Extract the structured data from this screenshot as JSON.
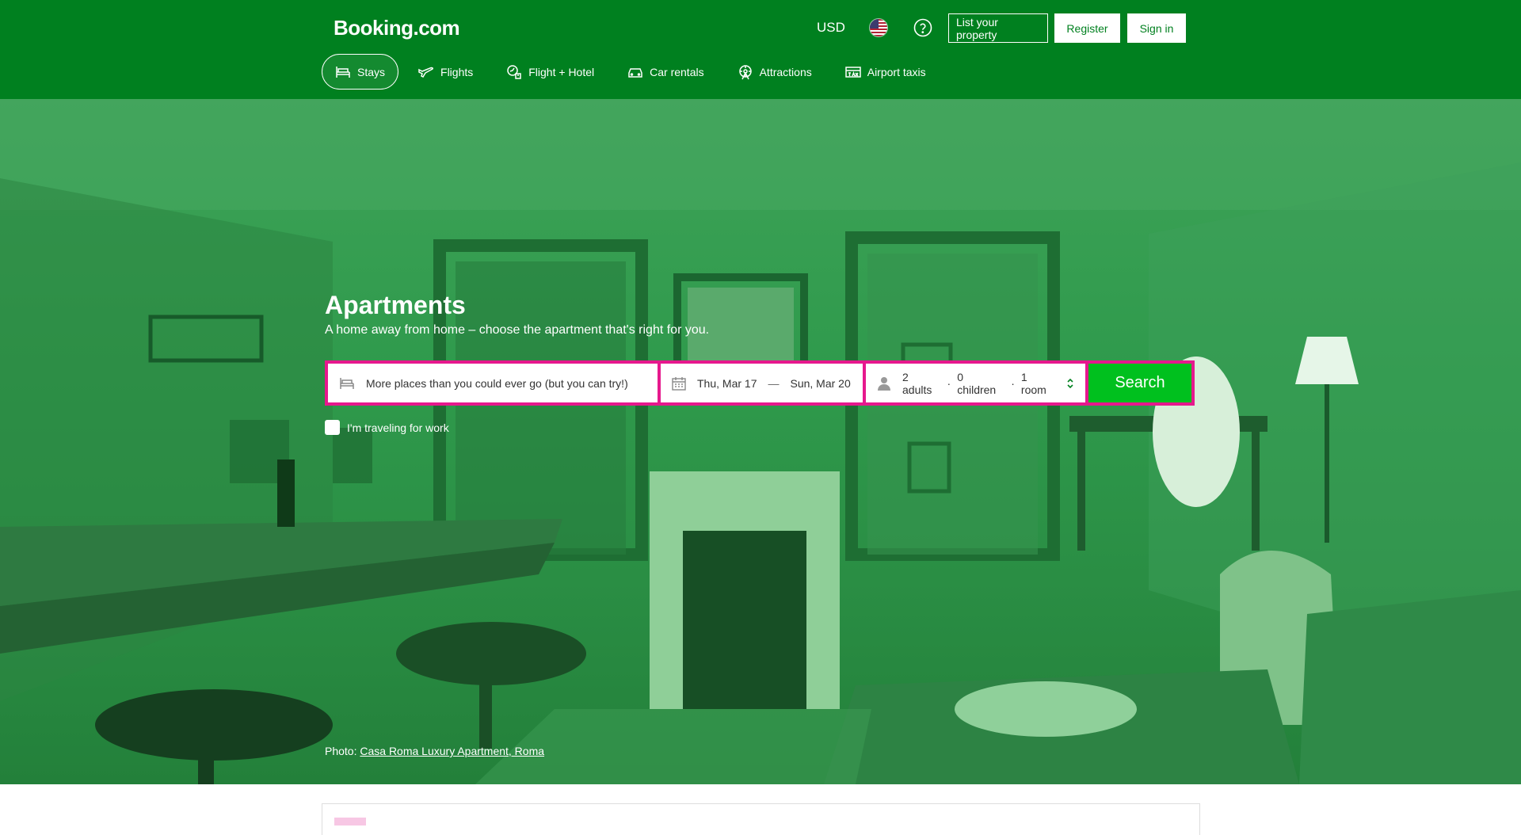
{
  "header": {
    "logo": "Booking.com",
    "currency": "USD",
    "list_property": "List your property",
    "register": "Register",
    "sign_in": "Sign in"
  },
  "nav": {
    "items": [
      {
        "label": "Stays",
        "icon": "bed-icon",
        "active": true
      },
      {
        "label": "Flights",
        "icon": "plane-icon",
        "active": false
      },
      {
        "label": "Flight + Hotel",
        "icon": "plane-hotel-icon",
        "active": false
      },
      {
        "label": "Car rentals",
        "icon": "car-icon",
        "active": false
      },
      {
        "label": "Attractions",
        "icon": "attractions-icon",
        "active": false
      },
      {
        "label": "Airport taxis",
        "icon": "taxi-icon",
        "active": false
      }
    ]
  },
  "hero": {
    "title": "Apartments",
    "subtitle": "A home away from home – choose the apartment that's right for you."
  },
  "search": {
    "destination_placeholder": "More places than you could ever go (but you can try!)",
    "checkin": "Thu, Mar 17",
    "date_separator": "—",
    "checkout": "Sun, Mar 20",
    "adults": "2 adults",
    "children": "0 children",
    "rooms": "1 room",
    "dot": "·",
    "button": "Search"
  },
  "work_travel": {
    "label": "I'm traveling for work"
  },
  "photo": {
    "prefix": "Photo: ",
    "link": "Casa Roma Luxury Apartment, Roma"
  },
  "colors": {
    "header": "#00801f",
    "search_border": "#e6188d",
    "search_button": "#00c01e"
  }
}
